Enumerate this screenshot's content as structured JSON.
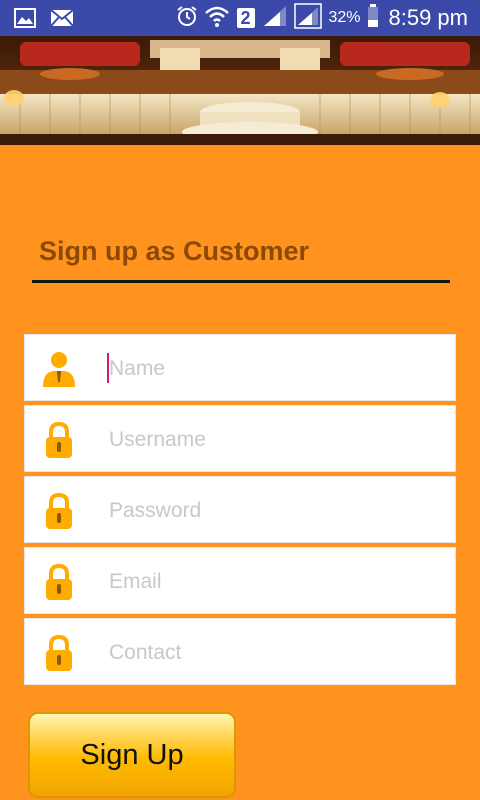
{
  "status_bar": {
    "battery_percent": "32%",
    "time": "8:59 pm",
    "sim_slot": "2",
    "left_icons": [
      "gallery-icon",
      "mail-icon"
    ],
    "right_icons": [
      "alarm-icon",
      "wifi-icon",
      "sim-2-icon",
      "signal-icon",
      "signal-icon",
      "battery-icon"
    ]
  },
  "banner": {
    "icon": "wedding-stage-image"
  },
  "page": {
    "title": "Sign up as Customer"
  },
  "form": {
    "fields": [
      {
        "placeholder": "Name",
        "icon": "user-icon"
      },
      {
        "placeholder": "Username",
        "icon": "lock-icon"
      },
      {
        "placeholder": "Password",
        "icon": "lock-icon"
      },
      {
        "placeholder": "Email",
        "icon": "lock-icon"
      },
      {
        "placeholder": "Contact",
        "icon": "lock-icon"
      }
    ],
    "submit_label": "Sign Up"
  },
  "colors": {
    "background": "#ff931e",
    "status_bar": "#3b4aa8",
    "title": "#8a4a05",
    "icon": "#ffab00",
    "button_gold": "#ffba00"
  }
}
